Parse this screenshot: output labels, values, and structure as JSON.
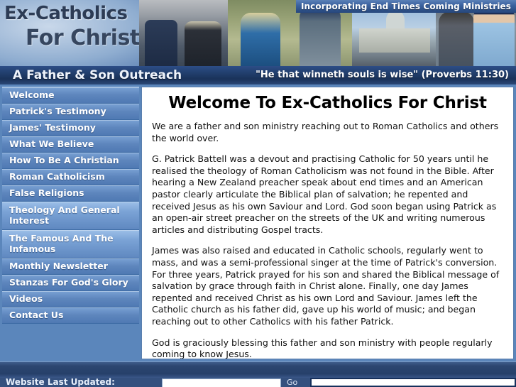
{
  "site": {
    "logo_line1": "Ex-Catholics",
    "logo_line2": "For Christ",
    "tagline": "A Father & Son Outreach",
    "scripture": "\"He that winneth souls is wise\"  (Proverbs 11:30)",
    "incorporating": "Incorporating End Times Coming Ministries"
  },
  "sidebar": {
    "items": [
      {
        "label": "Welcome",
        "active": false
      },
      {
        "label": "Patrick's Testimony",
        "active": false
      },
      {
        "label": "James' Testimony",
        "active": false
      },
      {
        "label": "What We Believe",
        "active": false
      },
      {
        "label": "How To Be A Christian",
        "active": false
      },
      {
        "label": "Roman Catholicism",
        "active": false
      },
      {
        "label": "False Religions",
        "active": false
      },
      {
        "label": "Theology And General Interest",
        "active": true
      },
      {
        "label": "The Famous And The Infamous",
        "active": true
      },
      {
        "label": "Monthly Newsletter",
        "active": false
      },
      {
        "label": "Stanzas For God's Glory",
        "active": false
      },
      {
        "label": "Videos",
        "active": false
      },
      {
        "label": "Contact Us",
        "active": false
      }
    ]
  },
  "main": {
    "heading": "Welcome To Ex-Catholics For Christ",
    "paragraphs": [
      " We are a father and son ministry reaching out to Roman Catholics and others the world over.",
      "G. Patrick Battell was a devout and practising Catholic for 50 years until he realised the theology of Roman Catholicism was not found in the Bible. After hearing a New Zealand preacher speak about end times and an American pastor clearly articulate the Biblical plan of salvation; he repented and received Jesus as his own Saviour and Lord. God soon began using Patrick as an open-air street preacher on the streets of the UK and writing numerous articles and distributing Gospel tracts.",
      " James was also raised and educated in Catholic schools, regularly went to mass, and was a semi-professional singer at the time of Patrick's conversion. For three years, Patrick prayed for his son and shared the Biblical message of salvation by grace through faith in Christ alone. Finally, one day James repented and received Christ as his own Lord and Saviour. James left the Catholic church as his father did, gave up his world of music; and began reaching out to other Catholics with his father Patrick.",
      " God is graciously blessing this father and son ministry with people regularly coming to know Jesus."
    ]
  },
  "footer": {
    "updated_label": "Website Last Updated:",
    "search_value": "",
    "search_placeholder": "",
    "go_label": "Go"
  },
  "colors": {
    "sidebar_bg": "#5b86bb",
    "nav_gradient_top": "#79a1d4",
    "nav_gradient_bottom": "#4f79b3",
    "nav_active_top": "#9dc0e8",
    "footer_band": "#2c4670",
    "ribbon": "#26477c",
    "content_bg": "#ffffff",
    "heading_color": "#000000"
  }
}
